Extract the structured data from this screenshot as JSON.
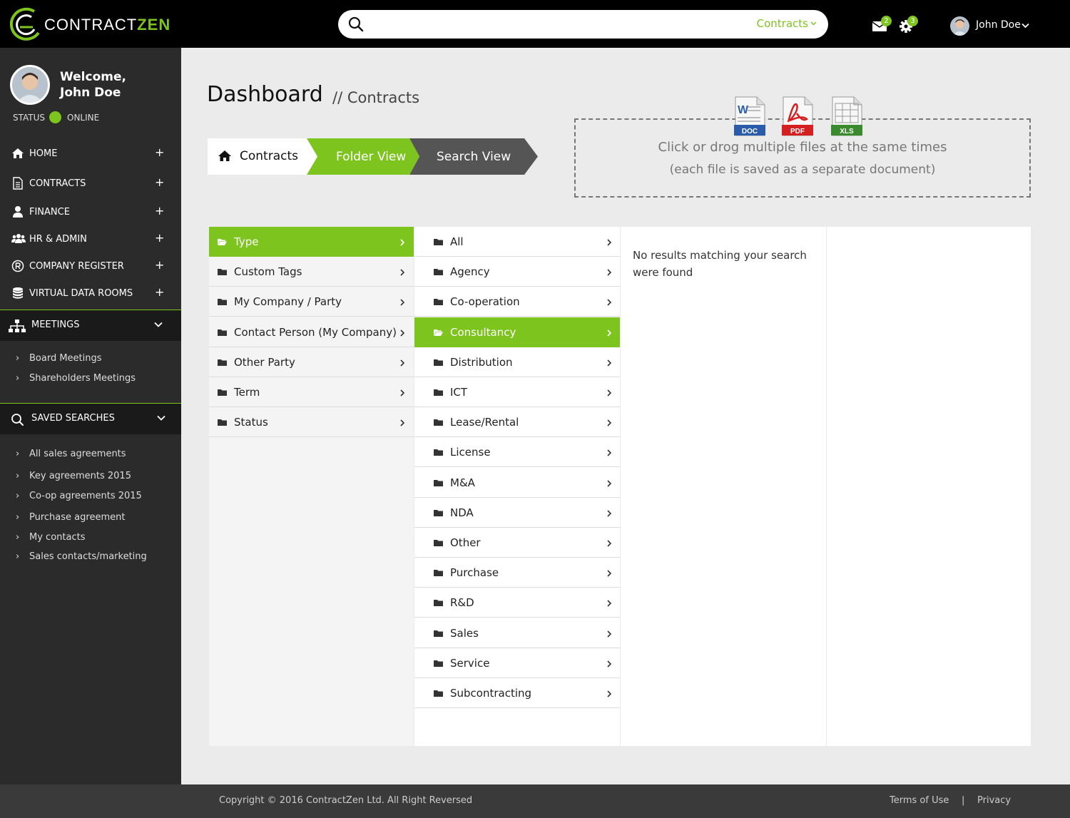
{
  "brand": {
    "name_part1": "CONTRACT",
    "name_part2": "ZEN"
  },
  "search": {
    "value": "",
    "placeholder": "",
    "scope": "Contracts"
  },
  "notifications": {
    "mail_count": "2",
    "settings_count": "3"
  },
  "user": {
    "name": "John Doe"
  },
  "sidebar": {
    "welcome_line1": "Welcome,",
    "welcome_line2": "John Doe",
    "status_label": "STATUS",
    "status_value": "ONLINE",
    "nav": [
      {
        "label": "HOME",
        "icon": "home-icon"
      },
      {
        "label": "CONTRACTS",
        "icon": "document-icon"
      },
      {
        "label": "FINANCE",
        "icon": "user-icon"
      },
      {
        "label": "HR  & ADMIN",
        "icon": "users-icon"
      },
      {
        "label": "COMPANY REGISTER",
        "icon": "registered-icon"
      },
      {
        "label": "VIRTUAL DATA ROOMS",
        "icon": "database-icon"
      }
    ],
    "meetings": {
      "label": "MEETINGS",
      "items": [
        "Board Meetings",
        "Shareholders Meetings"
      ]
    },
    "saved_searches": {
      "label": "SAVED SEARCHES",
      "items": [
        "All sales agreements",
        "Key agreements 2015",
        "Co-op agreements 2015",
        "Purchase agreement",
        "My contacts",
        "Sales contacts/marketing"
      ]
    }
  },
  "page": {
    "title": "Dashboard",
    "subtitle": "// Contracts"
  },
  "tabs": [
    {
      "label": "Contracts",
      "state": "home"
    },
    {
      "label": "Folder View",
      "state": "active"
    },
    {
      "label": "Search View",
      "state": "inactive"
    }
  ],
  "dropzone": {
    "line1": "Click or drog multiple files at the same times",
    "line2": "(each file is saved as a separate document)",
    "file_types": [
      "DOC",
      "PDF",
      "XLS"
    ]
  },
  "browser": {
    "column1": [
      "Type",
      "Custom Tags",
      "My Company / Party",
      "Contact Person (My Company)",
      "Other Party",
      "Term",
      "Status"
    ],
    "column1_active": 0,
    "column2": [
      "All",
      "Agency",
      "Co-operation",
      "Consultancy",
      "Distribution",
      "ICT",
      "Lease/Rental",
      "License",
      "M&A",
      "NDA",
      "Other",
      "Purchase",
      "R&D",
      "Sales",
      "Service",
      "Subcontracting"
    ],
    "column2_active": 3,
    "no_results": "No results matching your search were found"
  },
  "footer": {
    "copyright": "Copyright © 2016 ContractZen Ltd. All Right Reversed",
    "terms": "Terms of Use",
    "separator": "|",
    "privacy": "Privacy"
  },
  "colors": {
    "accent": "#7dc41e",
    "topbar": "#000000",
    "sidebar": "#2b2b2b",
    "footer": "#3a3a3a"
  }
}
